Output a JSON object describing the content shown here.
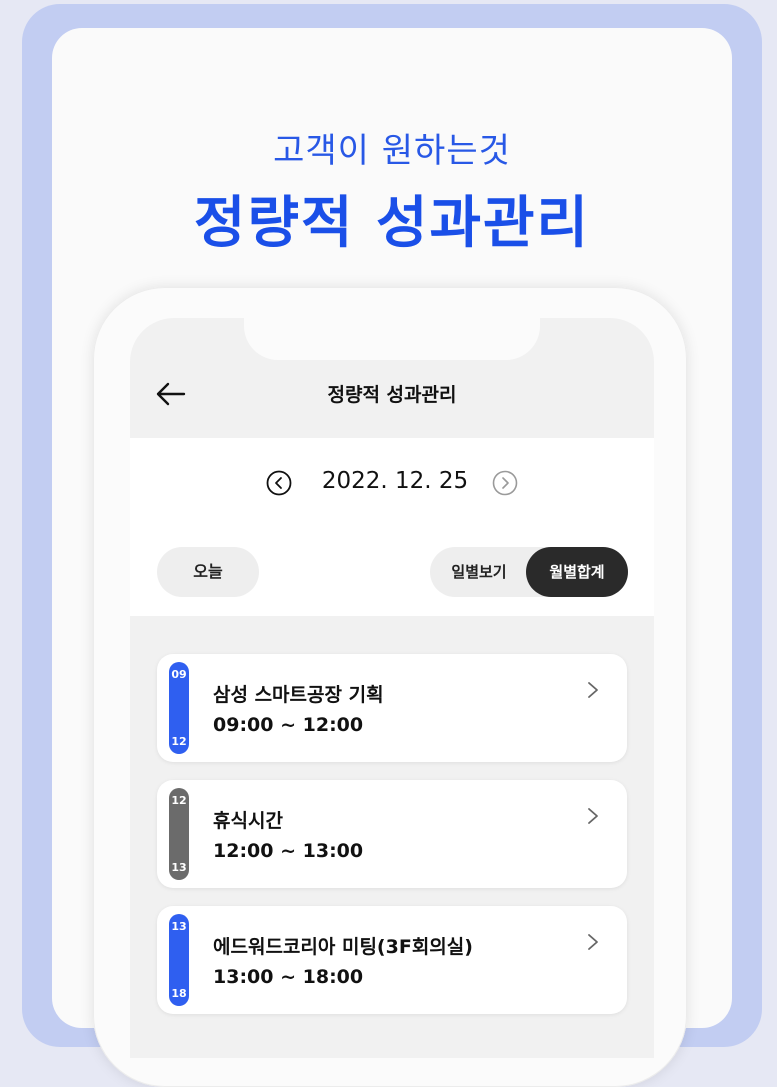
{
  "banner": {
    "subtitle": "고객이 원하는것",
    "headline": "정량적 성과관리"
  },
  "appbar": {
    "title": "정량적 성과관리"
  },
  "date_nav": {
    "date": "2022. 12. 25"
  },
  "controls": {
    "today_label": "오늘",
    "daily_view_label": "일별보기",
    "monthly_total_label": "월별합계"
  },
  "events": [
    {
      "start": "09",
      "end": "12",
      "title": "삼성 스마트공장 기획",
      "time": "09:00 ~ 12:00",
      "color": "#2f5ff0"
    },
    {
      "start": "12",
      "end": "13",
      "title": "휴식시간",
      "time": "12:00 ~ 13:00",
      "color": "#6b6b6b"
    },
    {
      "start": "13",
      "end": "18",
      "title": "에드워드코리아 미팅(3F회의실)",
      "time": "13:00 ~ 18:00",
      "color": "#2f5ff0"
    }
  ],
  "colors": {
    "accent": "#1a4fe8",
    "frame": "#c2cdf2",
    "dark_toggle": "#2a2a2a"
  },
  "icons": {
    "back": "back-arrow-icon",
    "prev": "chevron-left-circle-icon",
    "next": "chevron-right-circle-icon",
    "row": "chevron-right-icon"
  }
}
